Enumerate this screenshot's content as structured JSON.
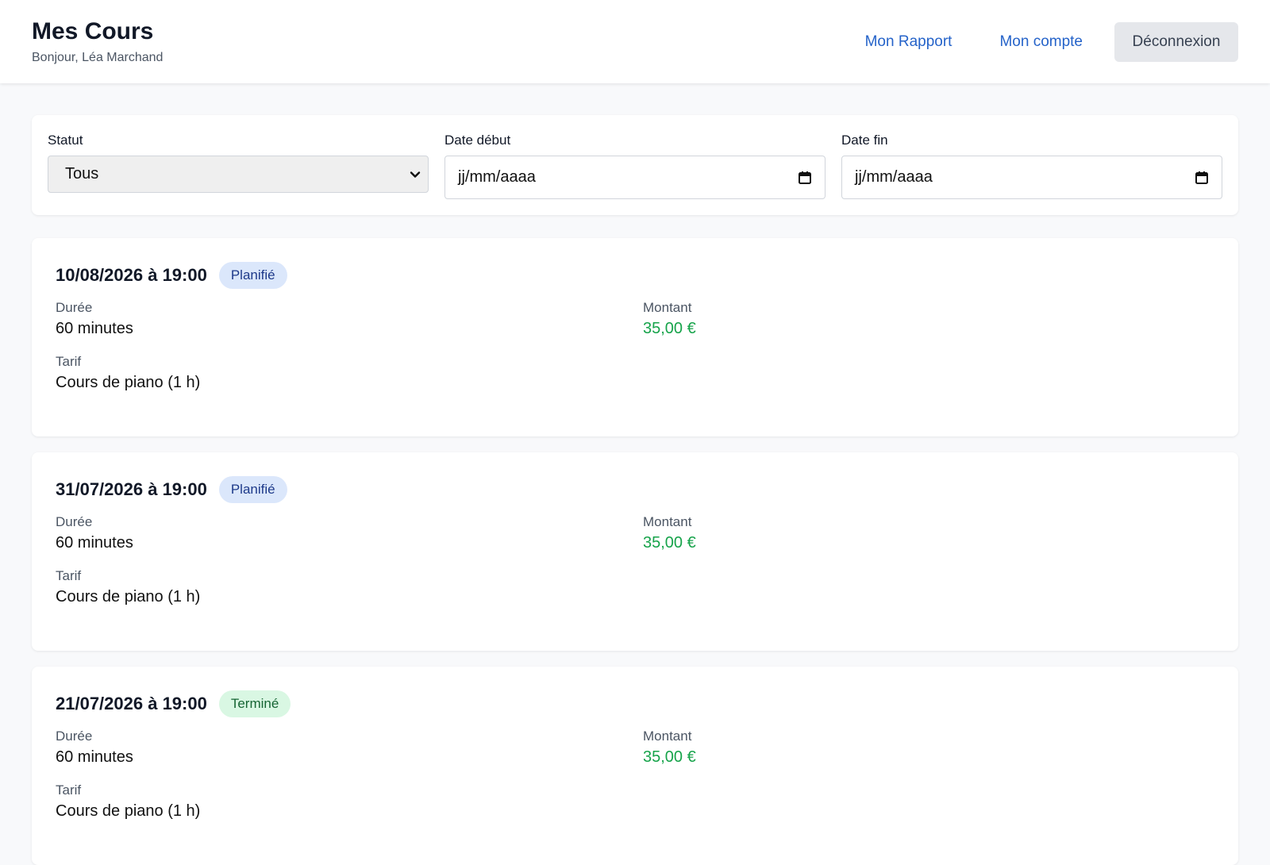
{
  "header": {
    "title": "Mes Cours",
    "greeting": "Bonjour, Léa Marchand",
    "nav": [
      "Mon Rapport",
      "Mon compte"
    ],
    "logout_label": "Déconnexion"
  },
  "filters": {
    "status_label": "Statut",
    "status_value": "Tous",
    "start_label": "Date début",
    "start_placeholder": "jj/mm/aaaa",
    "end_label": "Date fin",
    "end_placeholder": "jj/mm/aaaa"
  },
  "lessons": [
    {
      "datetime": "10/08/2026 à 19:00",
      "status": "Planifié",
      "duration_label": "Durée",
      "duration": "60 minutes",
      "amount_label": "Montant",
      "amount": "35,00 €",
      "rate_label": "Tarif",
      "rate": "Cours de piano (1 h)"
    },
    {
      "datetime": "31/07/2026 à 19:00",
      "status": "Planifié",
      "duration_label": "Durée",
      "duration": "60 minutes",
      "amount_label": "Montant",
      "amount": "35,00 €",
      "rate_label": "Tarif",
      "rate": "Cours de piano (1 h)"
    },
    {
      "datetime": "21/07/2026 à 19:00",
      "status": "Terminé",
      "duration_label": "Durée",
      "duration": "60 minutes",
      "amount_label": "Montant",
      "amount": "35,00 €",
      "rate_label": "Tarif",
      "rate": "Cours de piano (1 h)"
    }
  ],
  "colors": {
    "link": "#2563c9",
    "money": "#16a34a",
    "badge_planned_bg": "#dbe7fb",
    "badge_done_bg": "#d9f7e3"
  },
  "icons": {
    "select": "chevron-down-icon",
    "date": "calendar-icon"
  }
}
